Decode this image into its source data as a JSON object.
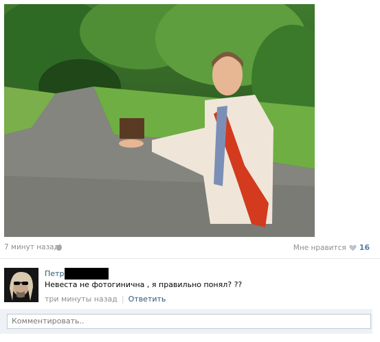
{
  "post": {
    "photo_alt_icon": "photo",
    "time_ago": "7 минут назад",
    "device_icon": "apple-icon",
    "like_label": "Мне нравится",
    "like_count": "16",
    "like_icon": "heart-icon"
  },
  "comment": {
    "author_visible": "Петр",
    "text": "Невеста не фотогинична , я правильно понял? ??",
    "time": "три минуты назад",
    "reply_label": "Ответить"
  },
  "reply_box": {
    "placeholder": "Комментировать.."
  },
  "colors": {
    "link": "#2b587a",
    "muted": "#8e8e8e",
    "like_count": "#5b7ca3",
    "reply_bg": "#eef1f5"
  }
}
